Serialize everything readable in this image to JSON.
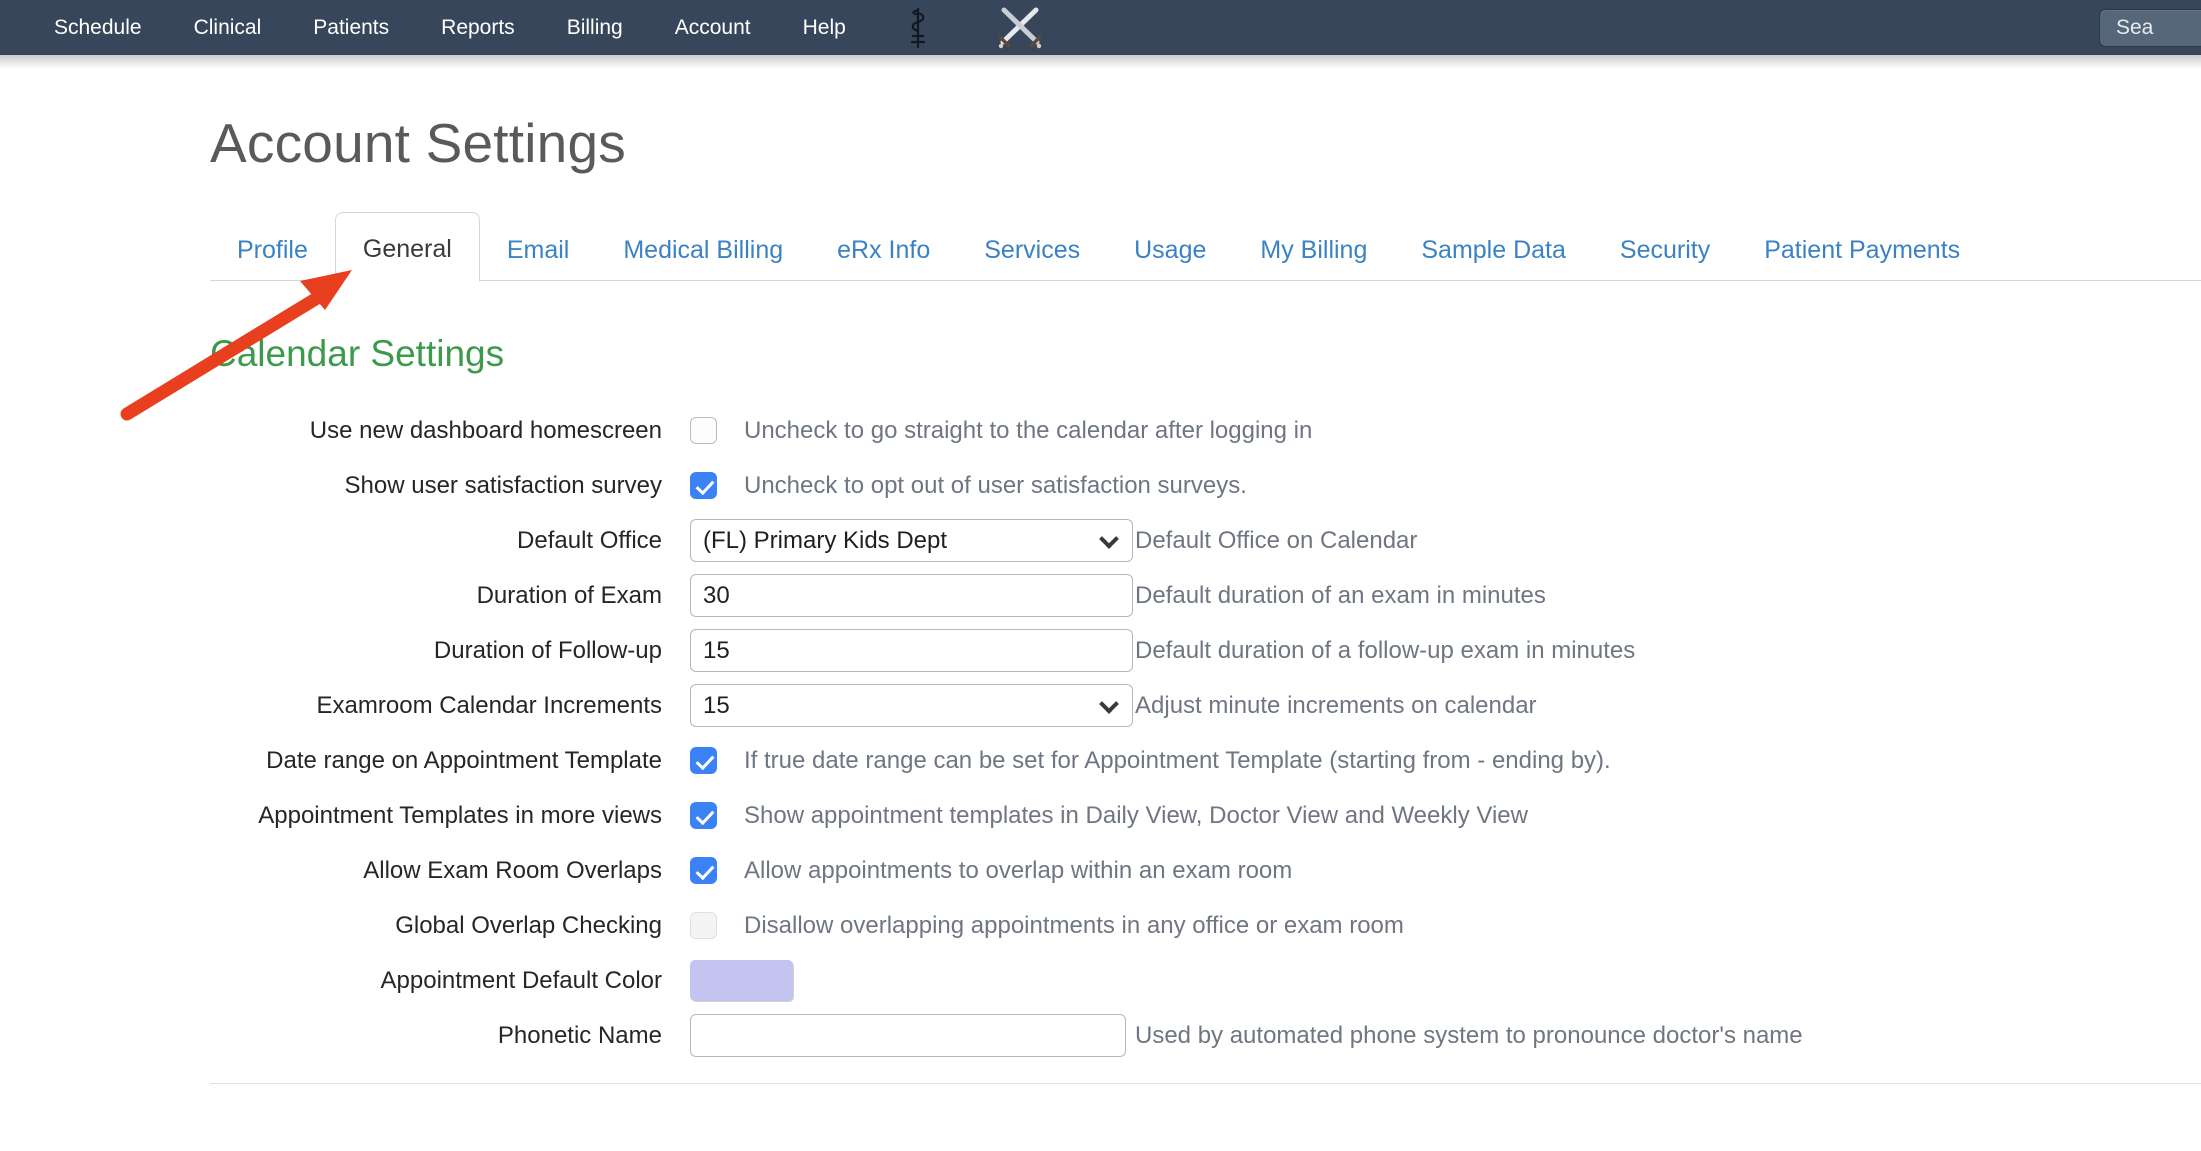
{
  "navbar": {
    "items": [
      {
        "label": "Schedule",
        "name": "nav-item-schedule"
      },
      {
        "label": "Clinical",
        "name": "nav-item-clinical"
      },
      {
        "label": "Patients",
        "name": "nav-item-patients"
      },
      {
        "label": "Reports",
        "name": "nav-item-reports"
      },
      {
        "label": "Billing",
        "name": "nav-item-billing"
      },
      {
        "label": "Account",
        "name": "nav-item-account"
      },
      {
        "label": "Help",
        "name": "nav-item-help"
      }
    ],
    "icons": [
      "caduceus-icon",
      "crossed-swords-icon"
    ],
    "search": {
      "value": "Sea",
      "placeholder": "Search"
    },
    "background_color": "#37465a"
  },
  "header": {
    "title": "Account Settings"
  },
  "tabs": {
    "active": "General",
    "items": [
      {
        "label": "Profile"
      },
      {
        "label": "General"
      },
      {
        "label": "Email"
      },
      {
        "label": "Medical Billing"
      },
      {
        "label": "eRx Info"
      },
      {
        "label": "Services"
      },
      {
        "label": "Usage"
      },
      {
        "label": "My Billing"
      },
      {
        "label": "Sample Data"
      },
      {
        "label": "Security"
      },
      {
        "label": "Patient Payments"
      }
    ],
    "link_color": "#3b82c4"
  },
  "section": {
    "title": "Calendar Settings",
    "title_color": "#3c9b4a"
  },
  "form": {
    "rows": [
      {
        "label": "Use new dashboard homescreen",
        "type": "checkbox",
        "checked": false,
        "help": "Uncheck to go straight to the calendar after logging in"
      },
      {
        "label": "Show user satisfaction survey",
        "type": "checkbox",
        "checked": true,
        "help": "Uncheck to opt out of user satisfaction surveys."
      },
      {
        "label": "Default Office",
        "type": "select",
        "value": "(FL) Primary Kids Dept",
        "options": [
          "(FL) Primary Kids Dept"
        ],
        "help": "Default Office on Calendar"
      },
      {
        "label": "Duration of Exam",
        "type": "text",
        "value": "30",
        "help": "Default duration of an exam in minutes"
      },
      {
        "label": "Duration of Follow-up",
        "type": "text",
        "value": "15",
        "help": "Default duration of a follow-up exam in minutes"
      },
      {
        "label": "Examroom Calendar Increments",
        "type": "select",
        "value": "15",
        "options": [
          "15"
        ],
        "help": "Adjust minute increments on calendar"
      },
      {
        "label": "Date range on Appointment Template",
        "type": "checkbox",
        "checked": true,
        "help": "If true date range can be set for Appointment Template (starting from - ending by)."
      },
      {
        "label": "Appointment Templates in more views",
        "type": "checkbox",
        "checked": true,
        "help": "Show appointment templates in Daily View, Doctor View and Weekly View"
      },
      {
        "label": "Allow Exam Room Overlaps",
        "type": "checkbox",
        "checked": true,
        "help": "Allow appointments to overlap within an exam room"
      },
      {
        "label": "Global Overlap Checking",
        "type": "checkbox",
        "checked": false,
        "disabled": true,
        "help": "Disallow overlapping appointments in any office or exam room"
      },
      {
        "label": "Appointment Default Color",
        "type": "color",
        "value": "#c3c4f0",
        "help": ""
      },
      {
        "label": "Phonetic Name",
        "type": "text",
        "value": "",
        "help": "Used by automated phone system to pronounce doctor's name"
      }
    ]
  },
  "annotation": {
    "arrow_color": "#e8401f",
    "points_at": "General"
  }
}
